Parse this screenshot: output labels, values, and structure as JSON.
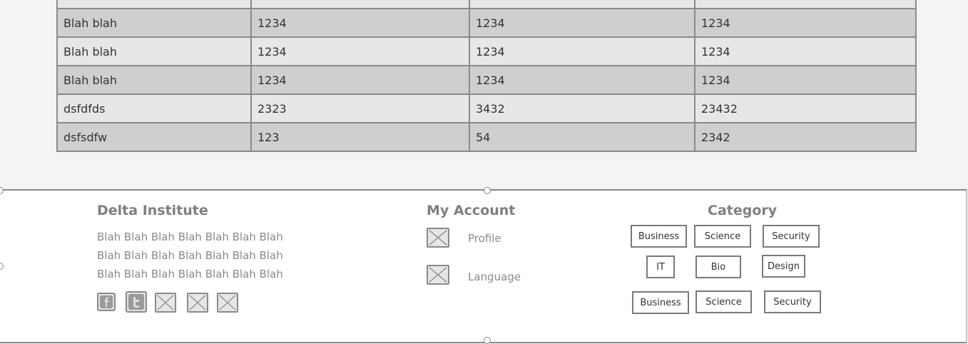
{
  "table": {
    "rows": [
      [
        "",
        "",
        "",
        ""
      ],
      [
        "Blah blah",
        "1234",
        "1234",
        "1234"
      ],
      [
        "Blah blah",
        "1234",
        "1234",
        "1234"
      ],
      [
        "Blah blah",
        "1234",
        "1234",
        "1234"
      ],
      [
        "dsfdfds",
        "2323",
        "3432",
        "23432"
      ],
      [
        "dsfsdfw",
        "123",
        "54",
        "2342"
      ]
    ]
  },
  "footer": {
    "institute": {
      "title": "Delta Institute",
      "lines": [
        "Blah Blah Blah Blah Blah Blah Blah",
        "Blah Blah Blah Blah Blah Blah Blah",
        "Blah Blah Blah Blah Blah Blah Blah"
      ],
      "social_icons": [
        "facebook-icon",
        "twitter-icon",
        "placeholder-icon",
        "placeholder-icon",
        "placeholder-icon"
      ]
    },
    "account": {
      "title": "My Account",
      "links": [
        "Profile",
        "Language"
      ]
    },
    "category": {
      "title": "Category",
      "tags": [
        "Business",
        "Science",
        "Security",
        "IT",
        "Bio",
        "Design",
        "Business",
        "Science",
        "Security"
      ]
    }
  }
}
